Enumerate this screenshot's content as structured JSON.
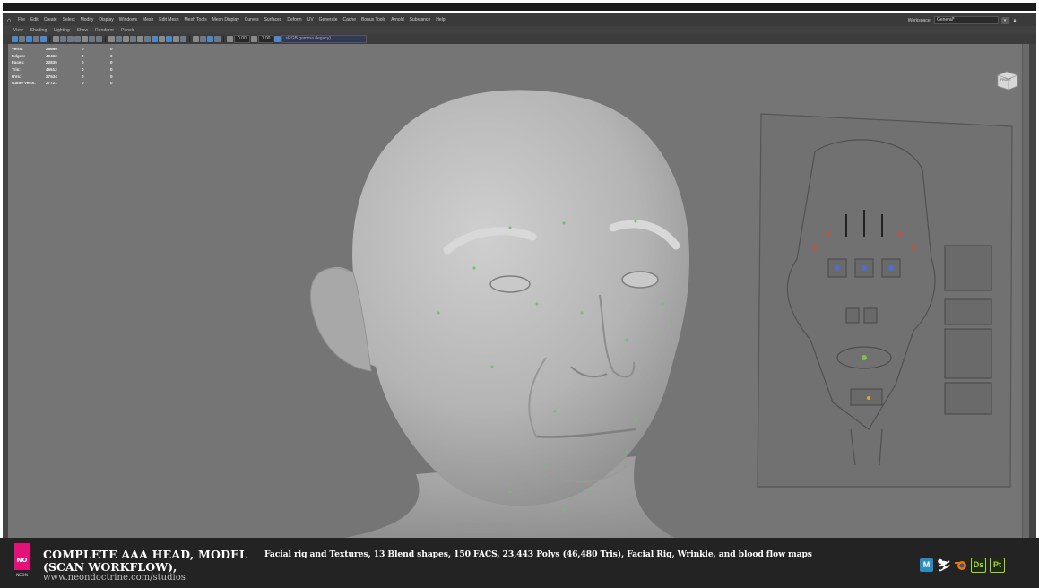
{
  "menubar": {
    "items": [
      "File",
      "Edit",
      "Create",
      "Select",
      "Modify",
      "Display",
      "Windows",
      "Mesh",
      "Edit Mesh",
      "Mesh Tools",
      "Mesh Display",
      "Curves",
      "Surfaces",
      "Deform",
      "UV",
      "Generate",
      "Cache",
      "Bonus Tools",
      "Arnold",
      "Substance",
      "Help"
    ],
    "workspace_label": "Workspace:",
    "workspace_value": "General*"
  },
  "panel_menu": [
    "View",
    "Shading",
    "Lighting",
    "Show",
    "Renderer",
    "Panels"
  ],
  "toolbar": {
    "field_a": "0.00",
    "field_b": "1.00",
    "colorspace": "sRGB gamma (legacy)"
  },
  "hud": [
    {
      "label": "Verts:",
      "v1": "26660",
      "v2": "0",
      "v3": "0"
    },
    {
      "label": "Edges:",
      "v1": "49462",
      "v2": "0",
      "v3": "0"
    },
    {
      "label": "Faces:",
      "v1": "22835",
      "v2": "0",
      "v3": "0"
    },
    {
      "label": "Tris:",
      "v1": "46512",
      "v2": "0",
      "v3": "0"
    },
    {
      "label": "UVs:",
      "v1": "27534",
      "v2": "0",
      "v3": "0"
    },
    {
      "label": "Game Verts:",
      "v1": "27721",
      "v2": "0",
      "v3": "0"
    }
  ],
  "viewcube_label": "FRONT",
  "banner": {
    "logo_text": "NEON",
    "title_line1": "COMPLETE AAA HEAD, MODEL",
    "title_line2": "(SCAN WORKFLOW),",
    "url": "www.neondoctrine.com/studios",
    "description": "Facial rig and Textures, 13 Blend shapes, 150 FACS, 23,443 Polys (46,480 Tris), Facial Rig, Wrinkle, and blood flow maps"
  },
  "software_icons": [
    {
      "name": "maya-icon",
      "label": "M",
      "color": "#2b8cc4"
    },
    {
      "name": "zbrush-icon",
      "label": "Z",
      "color": "#ffffff"
    },
    {
      "name": "blender-icon",
      "label": "B",
      "color": "#ea7600"
    },
    {
      "name": "substance-designer-icon",
      "label": "Ds",
      "color": "#a7d73a"
    },
    {
      "name": "substance-painter-icon",
      "label": "Pt",
      "color": "#a7d73a"
    }
  ],
  "colors": {
    "banner_bg": "#232323",
    "viewport_bg": "#757575",
    "logo_pink": "#e2127a"
  }
}
